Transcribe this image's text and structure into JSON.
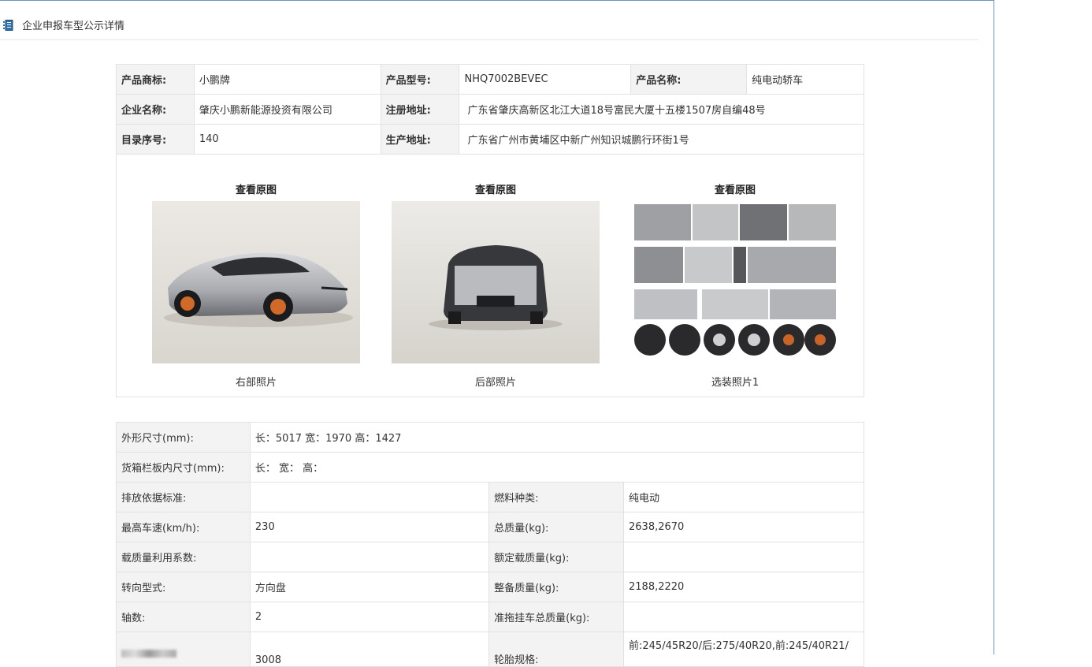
{
  "header": {
    "title": "企业申报车型公示详情"
  },
  "basic": {
    "rows": [
      [
        {
          "label": "产品商标:",
          "value": "小鹏牌"
        },
        {
          "label": "产品型号:",
          "value": "NHQ7002BEVEC"
        },
        {
          "label": "产品名称:",
          "value": "纯电动轿车"
        }
      ],
      [
        {
          "label": "企业名称:",
          "value": "肇庆小鹏新能源投资有限公司"
        },
        {
          "label": "注册地址:",
          "value": "广东省肇庆高新区北江大道18号富民大厦十五楼1507房自编48号"
        }
      ],
      [
        {
          "label": "目录序号:",
          "value": "140"
        },
        {
          "label": "生产地址:",
          "value": "广东省广州市黄埔区中新广州知识城鹏行环街1号"
        }
      ]
    ]
  },
  "photos": [
    {
      "link": "查看原图",
      "caption": "右部照片"
    },
    {
      "link": "查看原图",
      "caption": "后部照片"
    },
    {
      "link": "查看原图",
      "caption": "选装照片1"
    }
  ],
  "specs": {
    "dimensions": {
      "label": "外形尺寸(mm):",
      "value": "长：5017 宽：1970 高：1427"
    },
    "cargo": {
      "label": "货箱栏板内尺寸(mm):",
      "value": "长：  宽：  高："
    },
    "rows": [
      [
        {
          "label": "排放依据标准:",
          "value": ""
        },
        {
          "label": "燃料种类:",
          "value": "纯电动"
        }
      ],
      [
        {
          "label": "最高车速(km/h):",
          "value": "230"
        },
        {
          "label": "总质量(kg):",
          "value": "2638,2670"
        }
      ],
      [
        {
          "label": "载质量利用系数:",
          "value": ""
        },
        {
          "label": "额定载质量(kg):",
          "value": ""
        }
      ],
      [
        {
          "label": "转向型式:",
          "value": "方向盘"
        },
        {
          "label": "整备质量(kg):",
          "value": "2188,2220"
        }
      ],
      [
        {
          "label": "轴数:",
          "value": "2"
        },
        {
          "label": "准拖挂车总质量(kg):",
          "value": ""
        }
      ],
      [
        {
          "label": "",
          "value": "3008"
        },
        {
          "label": "轮胎规格:",
          "value": "前:245/45R20/后:275/40R20,前:245/40R21/"
        }
      ]
    ]
  }
}
